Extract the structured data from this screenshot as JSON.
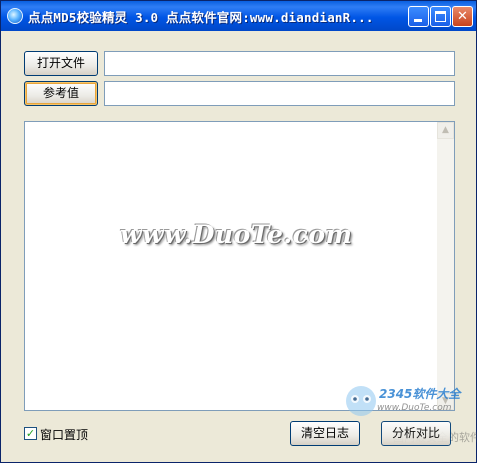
{
  "window": {
    "title": "点点MD5校验精灵 3.0  点点软件官网:www.diandianR...",
    "controls": {
      "minimize": "minimize",
      "maximize": "maximize",
      "close": "✕"
    }
  },
  "toolbar": {
    "open_file_label": "打开文件",
    "reference_label": "参考值",
    "file_path_value": "",
    "reference_value": ""
  },
  "log": {
    "content": "",
    "watermark": "www.DuoTe.com"
  },
  "footer": {
    "topmost_checkbox_label": "窗口置顶",
    "topmost_checked": true,
    "check_mark": "✓",
    "clear_log_label": "清空日志",
    "compare_label": "分析对比"
  },
  "overlay": {
    "brand": "2345软件大全",
    "url": "www.DuoTe.com",
    "sub": "国内最安全的软件站"
  },
  "icons": {
    "scroll_up": "▲",
    "scroll_down": "▼"
  }
}
